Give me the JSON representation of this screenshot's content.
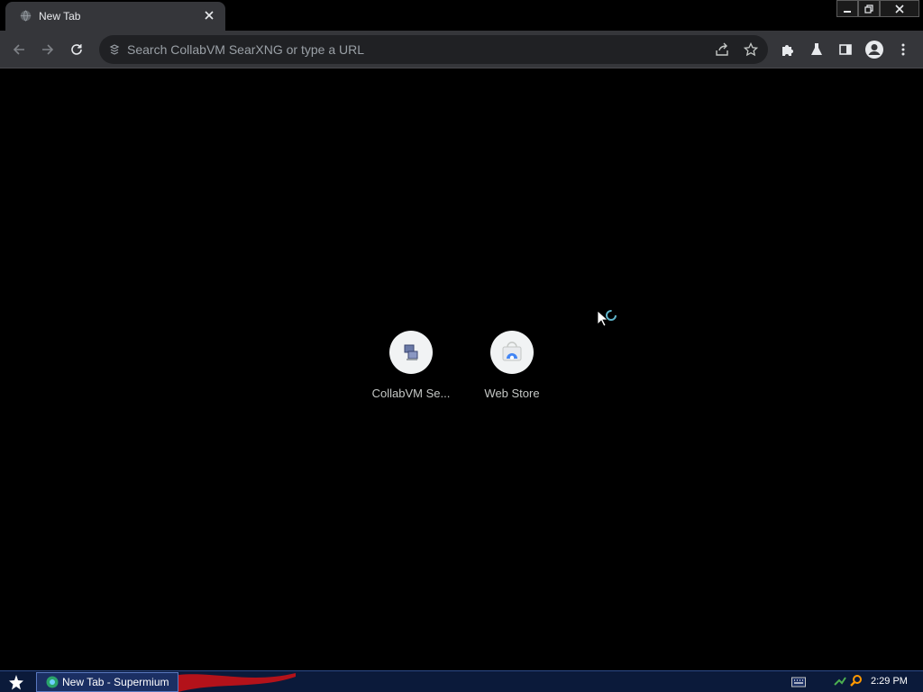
{
  "browser": {
    "tab": {
      "title": "New Tab",
      "favicon": "globe-icon",
      "close_icon": "close-icon"
    },
    "window_controls": [
      "minimize-icon",
      "restore-icon",
      "close-icon"
    ],
    "toolbar": {
      "back_icon": "arrow-left-icon",
      "forward_icon": "arrow-right-icon",
      "reload_icon": "reload-icon",
      "omnibox": {
        "placeholder": "Search CollabVM SearXNG or type a URL",
        "icon": "search-engine-icon"
      },
      "share_icon": "share-icon",
      "bookmark_icon": "star-icon",
      "extensions_icon": "puzzle-icon",
      "labs_icon": "flask-icon",
      "sidepanel_icon": "side-panel-icon",
      "profile_icon": "profile-icon",
      "menu_icon": "kebab-menu-icon"
    }
  },
  "new_tab": {
    "shortcuts": [
      {
        "label": "CollabVM Se...",
        "icon": "collabvm-icon"
      },
      {
        "label": "Web Store",
        "icon": "web-store-icon"
      }
    ]
  },
  "taskbar": {
    "start_icon": "start-star-icon",
    "task_label": "New Tab - Supermium",
    "clock": "2:29 PM",
    "tray_icons": [
      "keyboard-icon",
      "network-icon",
      "search-icon"
    ]
  },
  "colors": {
    "tab_bg": "#35363a",
    "toolbar_bg": "#35363a",
    "omnibox_bg": "#202124",
    "page_bg": "#000000",
    "taskbar_bg": "#0b1a3a"
  }
}
